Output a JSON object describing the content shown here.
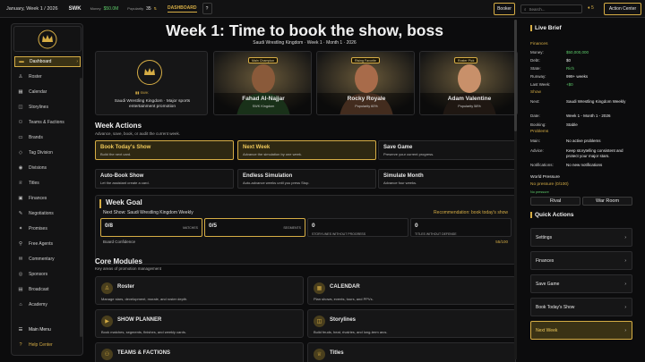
{
  "topbar": {
    "date": "January, Week 1 / 2026",
    "company": "SWK",
    "money_label": "Money",
    "money": "$50.0M",
    "popularity_label": "Popularity",
    "popularity": "35",
    "dashboard": "DASHBOARD",
    "help": "?",
    "booker": "Booker",
    "search_placeholder": "Search...",
    "notifications": "5",
    "action_center": "Action Center"
  },
  "sidebar": {
    "items": [
      {
        "label": "Dashboard",
        "icon": "dashboard-icon",
        "glyph": "▬"
      },
      {
        "label": "Roster",
        "icon": "roster-icon",
        "glyph": "♙"
      },
      {
        "label": "Calendar",
        "icon": "calendar-icon",
        "glyph": "▦"
      },
      {
        "label": "Storylines",
        "icon": "storylines-icon",
        "glyph": "◫"
      },
      {
        "label": "Teams & Factions",
        "icon": "teams-icon",
        "glyph": "⚇"
      },
      {
        "label": "Brands",
        "icon": "brands-icon",
        "glyph": "▭"
      },
      {
        "label": "Tag Division",
        "icon": "tag-icon",
        "glyph": "◇"
      },
      {
        "label": "Divisions",
        "icon": "divisions-icon",
        "glyph": "◉"
      },
      {
        "label": "Titles",
        "icon": "titles-icon",
        "glyph": "♕"
      },
      {
        "label": "Finances",
        "icon": "finances-icon",
        "glyph": "▣"
      },
      {
        "label": "Negotiations",
        "icon": "negotiations-icon",
        "glyph": "✎"
      },
      {
        "label": "Promises",
        "icon": "promises-icon",
        "glyph": "✦"
      },
      {
        "label": "Free Agents",
        "icon": "free-agents-icon",
        "glyph": "⚲"
      },
      {
        "label": "Commentary",
        "icon": "commentary-icon",
        "glyph": "✉"
      },
      {
        "label": "Sponsors",
        "icon": "sponsors-icon",
        "glyph": "◎"
      },
      {
        "label": "Broadcast",
        "icon": "broadcast-icon",
        "glyph": "▤"
      },
      {
        "label": "Academy",
        "icon": "academy-icon",
        "glyph": "⌂"
      }
    ],
    "main_menu": "Main Menu",
    "help_center": "Help Center"
  },
  "main": {
    "title": "Week 1: Time to book the show, boss",
    "subtitle": "Saudi Wrestling Kingdom · Week 1 · Month 1 · 2026",
    "promotion": {
      "brand": "SWK",
      "description": "Saudi Wrestling Kingdom · Major sports entertainment promotion"
    },
    "wrestlers": [
      {
        "tag": "Main Champion",
        "name": "Fahad Al-Najjar",
        "sub": "SWK Kingdom"
      },
      {
        "tag": "Rising Favorite",
        "name": "Rocky Royale",
        "sub": "Popularity 60%"
      },
      {
        "tag": "Roster Pick",
        "name": "Adam Valentine",
        "sub": "Popularity 58%"
      }
    ],
    "week_actions": {
      "title": "Week Actions",
      "desc": "Advance, save, book, or audit the current week.",
      "buttons": [
        {
          "title": "Book Today's Show",
          "desc": "Build the next card."
        },
        {
          "title": "Next Week",
          "desc": "Advance the simulation by one week."
        },
        {
          "title": "Save Game",
          "desc": "Preserve your current progress."
        },
        {
          "title": "Auto-Book Show",
          "desc": "Let the assistant create a card."
        },
        {
          "title": "Endless Simulation",
          "desc": "Auto-advance weeks until you press Stop."
        },
        {
          "title": "Simulate Month",
          "desc": "Advance four weeks."
        }
      ]
    },
    "week_goal": {
      "title": "Week Goal",
      "next_show": "Next Show: Saudi Wrestling Kingdom Weekly",
      "recommendation": "Recommendation: book today's show",
      "stats": [
        {
          "value": "0/8",
          "label": "MATCHES"
        },
        {
          "value": "0/5",
          "label": "SEGMENTS"
        },
        {
          "value": "0",
          "label": "STORYLINES WITHOUT PROGRESS"
        },
        {
          "value": "0",
          "label": "TITLES WITHOUT DEFENSE"
        }
      ],
      "confidence_label": "Board Confidence",
      "confidence_value": "55/100"
    },
    "core_modules": {
      "title": "Core Modules",
      "desc": "Key areas of promotion management",
      "items": [
        {
          "title": "Roster",
          "desc": "Manage stars, development, morale, and roster depth.",
          "icon": "roster-module-icon",
          "glyph": "♙"
        },
        {
          "title": "CALENDAR",
          "desc": "Plan shows, events, tours, and PPVs.",
          "icon": "calendar-module-icon",
          "glyph": "▦"
        },
        {
          "title": "SHOW PLANNER",
          "desc": "Book matches, segments, finishes, and weekly cards.",
          "icon": "show-planner-icon",
          "glyph": "▶"
        },
        {
          "title": "Storylines",
          "desc": "Build feuds, heat, rivalries, and long-term arcs.",
          "icon": "storylines-module-icon",
          "glyph": "◫"
        },
        {
          "title": "TEAMS & FACTIONS",
          "desc": "",
          "icon": "teams-module-icon",
          "glyph": "⚇"
        },
        {
          "title": "Titles",
          "desc": "",
          "icon": "titles-module-icon",
          "glyph": "♕"
        }
      ]
    }
  },
  "right": {
    "live_brief": "Live Brief",
    "finances_label": "Finances",
    "finances": [
      {
        "k": "Money:",
        "v": "$50,000,000",
        "green": true
      },
      {
        "k": "Debt:",
        "v": "$0",
        "green": false
      },
      {
        "k": "State:",
        "v": "Rich",
        "green": true
      },
      {
        "k": "Runway:",
        "v": "999+ weeks",
        "green": false
      },
      {
        "k": "Last Week:",
        "v": "+$0",
        "green": true
      }
    ],
    "show_label": "Show",
    "show": [
      {
        "k": "Next:",
        "v": "Saudi Wrestling Kingdom Weekly"
      },
      {
        "k": "Date:",
        "v": "Week 1 - Month 1 - 2026"
      },
      {
        "k": "Booking:",
        "v": "Stable"
      }
    ],
    "problems_label": "Problems",
    "problems": [
      {
        "k": "Main:",
        "v": "No active problems"
      },
      {
        "k": "Advice:",
        "v": "Keep storytelling consistent and protect your major stars."
      },
      {
        "k": "Notifications:",
        "v": "No new notifications"
      }
    ],
    "war_pressure_label": "World Pressure",
    "war_pressure_value": "No pressure (0/100)",
    "war_pressure_note": "No pressure",
    "rival": "Rival",
    "war_room": "War Room",
    "quick_actions": "Quick Actions",
    "quick": [
      "Settings",
      "Finances",
      "Save Game",
      "Book Today's Show",
      "Next Week"
    ]
  },
  "colors": {
    "accent": "#d6ad45",
    "positive": "#5fce6c",
    "background": "#0c0c0d"
  }
}
